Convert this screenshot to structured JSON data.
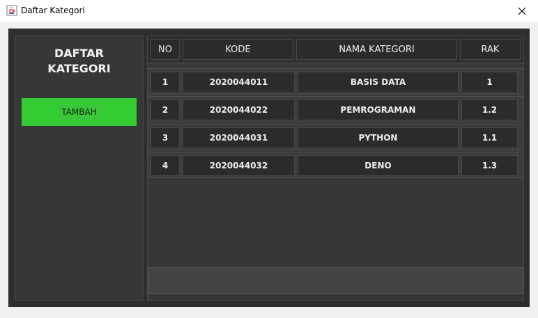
{
  "window": {
    "title": "Daftar Kategori",
    "close_symbol": "✕"
  },
  "sidebar": {
    "title_line1": "DAFTAR",
    "title_line2": "KATEGORI",
    "add_button_label": "TAMBAH",
    "add_button_color": "#33cc33"
  },
  "table": {
    "columns": [
      "NO",
      "KODE",
      "NAMA KATEGORI",
      "RAK"
    ],
    "rows": [
      {
        "no": "1",
        "kode": "2020044011",
        "nama": "BASIS DATA",
        "rak": "1"
      },
      {
        "no": "2",
        "kode": "2020044022",
        "nama": "PEMROGRAMAN",
        "rak": "1.2"
      },
      {
        "no": "3",
        "kode": "2020044031",
        "nama": "PYTHON",
        "rak": "1.1"
      },
      {
        "no": "4",
        "kode": "2020044032",
        "nama": "DENO",
        "rak": "1.3"
      }
    ]
  },
  "icons": {
    "app": "java-coffee-icon",
    "close": "close-icon"
  }
}
